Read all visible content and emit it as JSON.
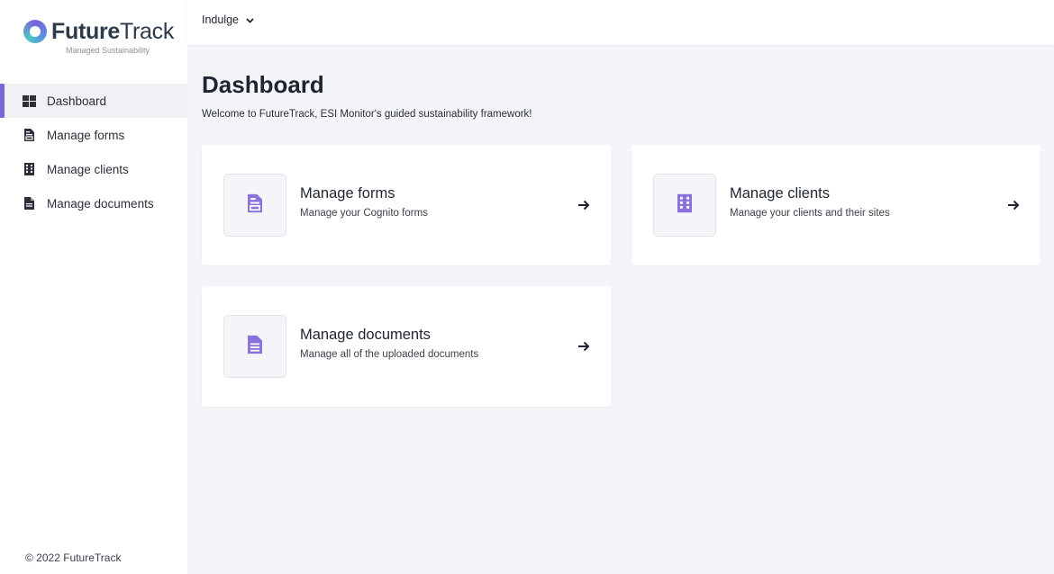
{
  "brand": {
    "name_part1": "Future",
    "name_part2": "Track",
    "tagline": "Managed Sustainability",
    "accent_color": "#7a62d8"
  },
  "topbar": {
    "org_selected": "Indulge"
  },
  "sidebar": {
    "items": [
      {
        "label": "Dashboard",
        "icon": "grid-icon",
        "active": true
      },
      {
        "label": "Manage forms",
        "icon": "form-icon",
        "active": false
      },
      {
        "label": "Manage clients",
        "icon": "building-icon",
        "active": false
      },
      {
        "label": "Manage documents",
        "icon": "document-icon",
        "active": false
      }
    ],
    "footer": "© 2022 FutureTrack"
  },
  "main": {
    "title": "Dashboard",
    "subtitle": "Welcome to FutureTrack, ESI Monitor's guided sustainability framework!",
    "cards": [
      {
        "title": "Manage forms",
        "description": "Manage your Cognito forms",
        "icon": "form-icon"
      },
      {
        "title": "Manage clients",
        "description": "Manage your clients and their sites",
        "icon": "building-icon"
      },
      {
        "title": "Manage documents",
        "description": "Manage all of the uploaded documents",
        "icon": "document-icon"
      }
    ]
  }
}
